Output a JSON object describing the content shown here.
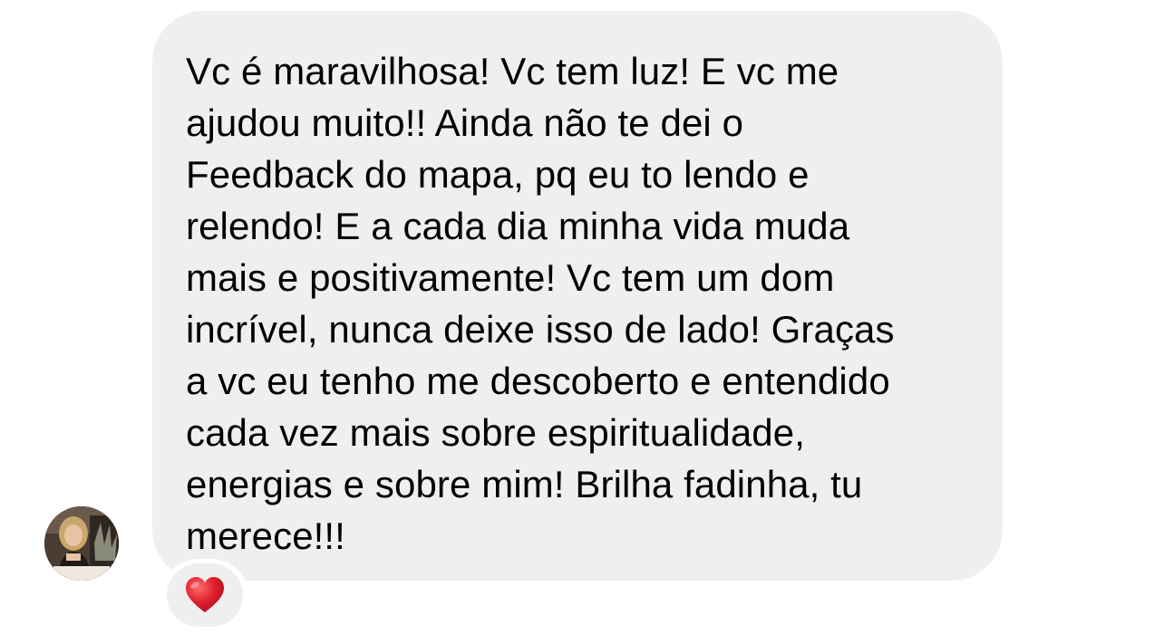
{
  "message": {
    "lines": [
      "Vc é maravilhosa! Vc tem luz! E vc me",
      "ajudou muito!! Ainda não te dei o",
      "Feedback do mapa, pq eu to lendo e",
      "relendo! E a cada dia minha vida muda",
      "mais e positivamente! Vc tem um dom",
      "incrível, nunca deixe isso de lado! Graças",
      "a vc eu tenho me descoberto e entendido",
      "cada vez mais sobre espiritualidade,",
      "energias e sobre mim! Brilha fadinha, tu",
      "merece!!!"
    ],
    "bubble_color": "#efefef",
    "text_color": "#000000"
  },
  "sender": {
    "avatar_icon": "user-avatar-photo"
  },
  "reaction": {
    "icon": "red-heart-icon",
    "color": "#e0202d"
  }
}
